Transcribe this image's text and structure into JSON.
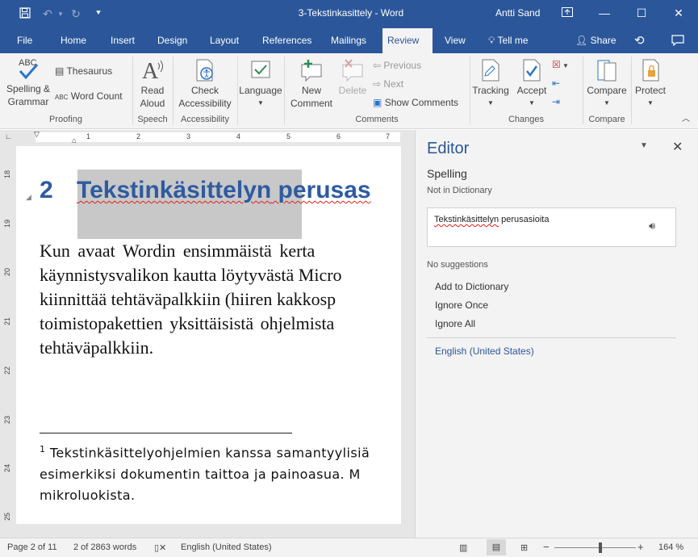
{
  "titlebar": {
    "title": "3-Tekstinkasittely  -  Word",
    "user": "Antti Sand"
  },
  "tabs": [
    "File",
    "Home",
    "Insert",
    "Design",
    "Layout",
    "References",
    "Mailings",
    "Review",
    "View"
  ],
  "active_tab": "Review",
  "tell_me": "Tell me",
  "share": "Share",
  "ribbon": {
    "spelling": [
      "Spelling &",
      "Grammar"
    ],
    "thesaurus": "Thesaurus",
    "word_count": "Word Count",
    "read_aloud": [
      "Read",
      "Aloud"
    ],
    "check_accessibility": [
      "Check",
      "Accessibility"
    ],
    "language": "Language",
    "new_comment": [
      "New",
      "Comment"
    ],
    "delete": "Delete",
    "previous": "Previous",
    "next": "Next",
    "show_comments": "Show Comments",
    "tracking": "Tracking",
    "accept": "Accept",
    "compare": "Compare",
    "protect": "Protect",
    "groups": {
      "proofing": "Proofing",
      "speech": "Speech",
      "accessibility": "Accessibility",
      "comments": "Comments",
      "changes": "Changes",
      "compare": "Compare"
    }
  },
  "ruler": {
    "h": [
      "1",
      "2",
      "3",
      "4",
      "5",
      "6",
      "7"
    ],
    "v": [
      "18",
      "19",
      "20",
      "21",
      "22",
      "23",
      "24",
      "25"
    ]
  },
  "document": {
    "heading_num": "2",
    "heading_selected": "Tekstinkäsittelyn",
    "heading_rest": " perusas",
    "body": [
      "Kun  avaat  Wordin  ensimmäistä  kerta",
      "käynnistysvalikon kautta löytyvästä Micro",
      "kiinnittää tehtäväpalkkiin (hiiren kakkosp",
      "toimistopakettien  yksittäisistä  ohjelmista",
      "tehtäväpalkkiin."
    ],
    "footnote_mark": "1",
    "footnote": [
      " Tekstinkäsittelyohjelmien  kanssa  samantyylisiä",
      "esimerkiksi  dokumentin  taittoa  ja  painoasua.  M",
      "mikroluokista."
    ]
  },
  "editor": {
    "title": "Editor",
    "section": "Spelling",
    "subtitle": "Not in Dictionary",
    "context_word": "Tekstinkäsittelyn",
    "context_rest": " perusasioita",
    "no_suggestions": "No suggestions",
    "actions": [
      "Add to Dictionary",
      "Ignore Once",
      "Ignore All"
    ],
    "language": "English (United States)"
  },
  "status": {
    "page": "Page 2 of 11",
    "words": "2 of 2863 words",
    "language": "English (United States)",
    "zoom": "164 %",
    "zoom_minus": "−",
    "zoom_plus": "+"
  },
  "colors": {
    "brand": "#2b579a",
    "heading": "#2e5ba0",
    "link": "#2b579a"
  }
}
